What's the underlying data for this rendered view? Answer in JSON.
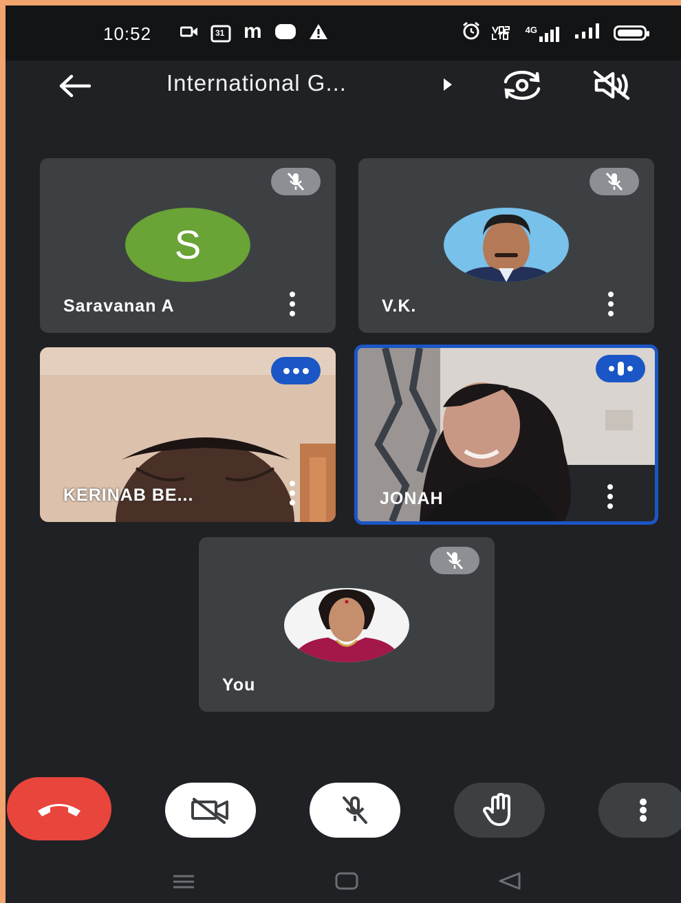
{
  "status_bar": {
    "time": "10:52",
    "calendar_day": "31",
    "carrier_letter": "m",
    "network_label": "4G"
  },
  "header": {
    "title": "International G...",
    "back_icon": "arrow-left-icon",
    "switch_camera_icon": "camera-flip-icon",
    "speaker_icon": "speaker-off-icon"
  },
  "participants": [
    {
      "name": "Saravanan A",
      "avatar_letter": "S",
      "avatar_color": "#6aa336",
      "audio": "muted"
    },
    {
      "name": "V.K.",
      "avatar": "photo",
      "audio": "muted"
    },
    {
      "name": "KERINAB BE...",
      "video": "on",
      "audio": "loading"
    },
    {
      "name": "JONAH",
      "video": "on",
      "audio": "speaking",
      "active_speaker": true
    },
    {
      "name": "You",
      "avatar": "photo",
      "audio": "muted"
    }
  ],
  "controls": {
    "end_call_icon": "end-call-icon",
    "camera_icon": "camera-off-icon",
    "mic_icon": "mic-off-icon",
    "raise_hand_icon": "raise-hand-icon",
    "more_icon": "more-vertical-icon"
  },
  "colors": {
    "frame": "#f2a46e",
    "background": "#202124",
    "tile": "#3c4043",
    "active_border": "#1a56c6",
    "end_call": "#e8453c",
    "mute_badge": "#8c8f94"
  }
}
